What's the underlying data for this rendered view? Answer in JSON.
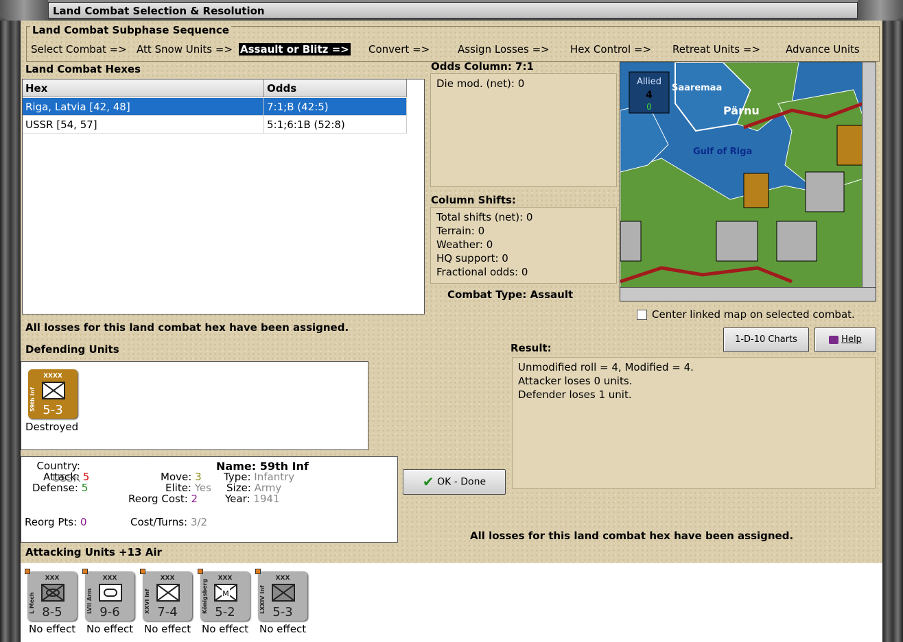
{
  "window": {
    "title": "Land Combat Selection & Resolution"
  },
  "sequence": {
    "title": "Land Combat Subphase Sequence",
    "steps": [
      "Select Combat =>",
      "Att Snow Units =>",
      "Assault or Blitz =>",
      "Convert =>",
      "Assign Losses =>",
      "Hex Control =>",
      "Retreat Units =>",
      "Advance Units"
    ],
    "current_index": 2
  },
  "hexes": {
    "title": "Land Combat Hexes",
    "columns": [
      "Hex",
      "Odds"
    ],
    "rows": [
      {
        "hex": "Riga, Latvia [42, 48]",
        "odds": "7:1;B (42:5)",
        "selected": true
      },
      {
        "hex": "USSR [54, 57]",
        "odds": "5:1;6:1B (52:8)",
        "selected": false
      }
    ]
  },
  "odds": {
    "title": "Odds Column: 7:1",
    "die_mod": "Die mod. (net): 0"
  },
  "shifts": {
    "title": "Column Shifts:",
    "lines": [
      "Total shifts (net): 0",
      "Terrain: 0",
      "Weather: 0",
      "HQ support: 0",
      "Fractional odds: 0"
    ]
  },
  "combat_type": {
    "label": "Combat Type:",
    "value": "Assault"
  },
  "map": {
    "allied_label": "Allied",
    "allied_count": "4",
    "allied_sub": "0",
    "labels": [
      "Saaremaa",
      "Pärnu",
      "Gulf of Riga"
    ],
    "colors": {
      "sea": "#2a6fb0",
      "land": "#5f9a3a",
      "border": "#a01c1c"
    }
  },
  "center_linked": {
    "label": "Center linked map on selected combat.",
    "checked": false
  },
  "buttons": {
    "charts": "1-D-10 Charts",
    "help": "Help",
    "ok": "OK - Done"
  },
  "losses_msg": "All losses for this land combat hex have been assigned.",
  "defending": {
    "title": "Defending Units",
    "units": [
      {
        "name": "59th Inf",
        "size": "XXXX",
        "strength": "5-3",
        "status": "Destroyed"
      }
    ]
  },
  "result": {
    "title": "Result:",
    "lines": [
      "Unmodified roll = 4, Modified = 4.",
      "Attacker loses 0 units.",
      "Defender loses 1 unit."
    ]
  },
  "unit_info": {
    "country_label": "Country:",
    "country": "USSR",
    "attack_label": "Attack:",
    "attack": "5",
    "defense_label": "Defense:",
    "defense": "5",
    "reorg_pts_label": "Reorg Pts:",
    "reorg_pts": "0",
    "name_label": "Name:",
    "name": "59th Inf",
    "move_label": "Move:",
    "move": "3",
    "type_label": "Type:",
    "type": "Infantry",
    "elite_label": "Elite:",
    "elite": "Yes",
    "size_label": "Size:",
    "size": "Army",
    "reorg_cost_label": "Reorg Cost:",
    "reorg_cost": "2",
    "year_label": "Year:",
    "year": "1941",
    "cost_turns_label": "Cost/Turns:",
    "cost_turns": "3/2"
  },
  "attacking": {
    "title": "Attacking Units +13 Air",
    "units": [
      {
        "name": "L Mech",
        "size": "XXX",
        "strength": "8-5",
        "status": "No effect"
      },
      {
        "name": "LVII Arm",
        "size": "XXX",
        "strength": "9-6",
        "status": "No effect"
      },
      {
        "name": "XXVI Inf",
        "size": "XXX",
        "strength": "7-4",
        "status": "No effect"
      },
      {
        "name": "Königsberg",
        "size": "XXX",
        "strength": "5-2",
        "status": "No effect"
      },
      {
        "name": "LXXIV Inf",
        "size": "XXX",
        "strength": "5-3",
        "status": "No effect"
      }
    ]
  }
}
